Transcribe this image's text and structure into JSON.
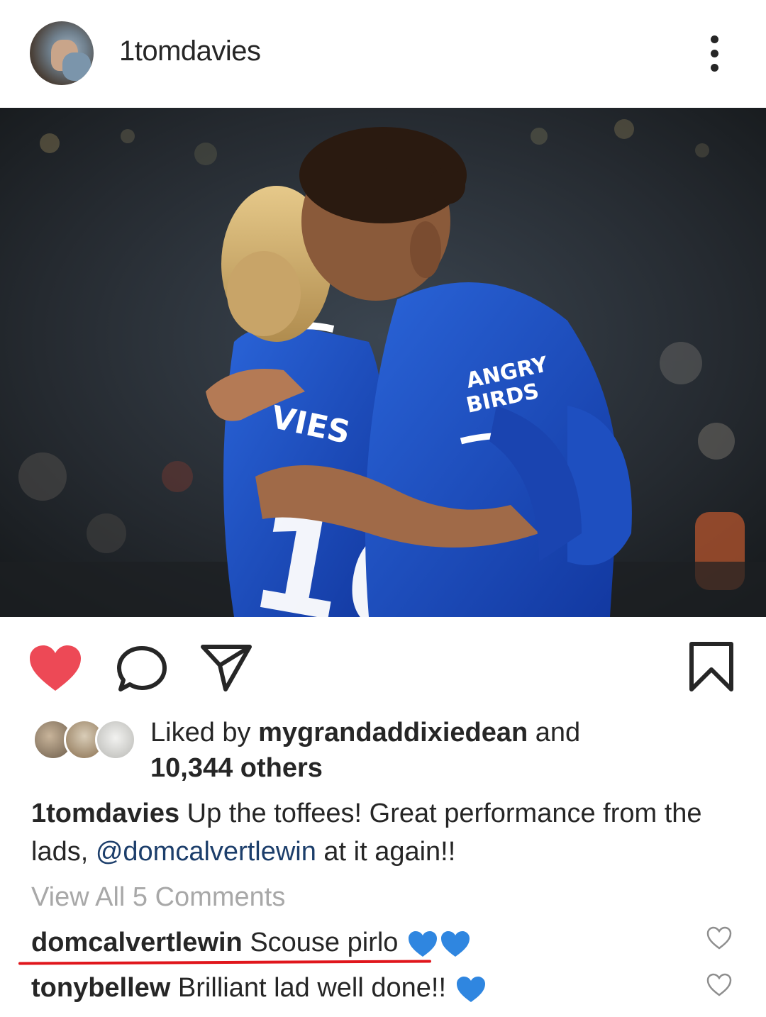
{
  "post": {
    "username": "1tomdavies",
    "photo_jersey_sponsor": "ANGRY BIRDS",
    "photo_jersey_name": "VIES",
    "likes": {
      "prefix": "Liked by ",
      "liker": "mygrandaddixiedean",
      "and": " and",
      "others": "10,344 others"
    },
    "caption": {
      "username": "1tomdavies",
      "text_before": " Up the toffees! Great performance from the lads, ",
      "mention": "@domcalvertlewin",
      "text_after": " at it again!!"
    },
    "view_all_comments": "View All 5 Comments",
    "comments": [
      {
        "username": "domcalvertlewin",
        "text": " Scouse pirlo ",
        "emoji": "blue-heart x2"
      },
      {
        "username": "tonybellew",
        "text": " Brilliant lad well done!! ",
        "emoji": "blue-heart x1"
      }
    ]
  },
  "icons": [
    "more-options-icon",
    "like-heart-icon",
    "comment-icon",
    "share-icon",
    "bookmark-icon",
    "comment-like-icon"
  ],
  "colors": {
    "like_red": "#ed4956",
    "text": "#262626",
    "muted": "#a8a8a8",
    "mention": "#1c3e6b",
    "everton_blue": "#1a4fc4",
    "underline_red": "#e0161c"
  }
}
